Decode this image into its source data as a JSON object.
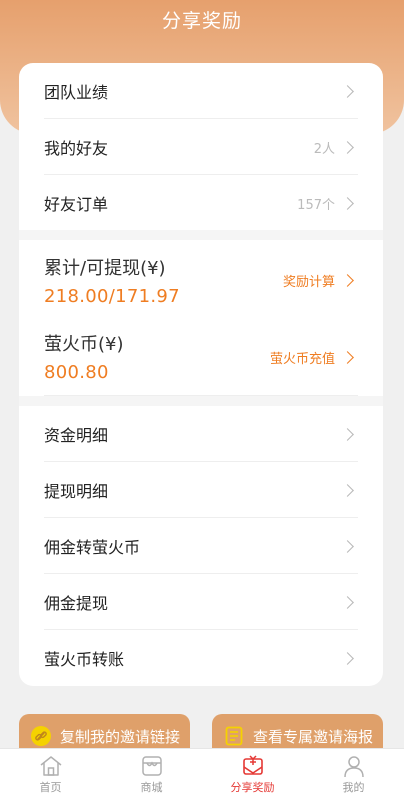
{
  "header": {
    "title": "分享奖励"
  },
  "menu_top": [
    {
      "label": "团队业绩",
      "count": ""
    },
    {
      "label": "我的好友",
      "count": "2人"
    },
    {
      "label": "好友订单",
      "count": "157个"
    }
  ],
  "stats": [
    {
      "label": "累计/可提现(¥)",
      "value": "218.00/171.97",
      "link": "奖励计算"
    },
    {
      "label": "萤火币(¥)",
      "value": "800.80",
      "link": "萤火币充值"
    }
  ],
  "menu_bottom": [
    {
      "label": "资金明细"
    },
    {
      "label": "提现明细"
    },
    {
      "label": "佣金转萤火币"
    },
    {
      "label": "佣金提现"
    },
    {
      "label": "萤火币转账"
    }
  ],
  "actions": {
    "copy_link": "复制我的邀请链接",
    "view_poster": "查看专属邀请海报"
  },
  "tabbar": {
    "items": [
      {
        "label": "首页",
        "icon": "home-icon"
      },
      {
        "label": "商城",
        "icon": "shop-icon"
      },
      {
        "label": "分享奖励",
        "icon": "share-reward-icon",
        "active": true
      },
      {
        "label": "我的",
        "icon": "user-icon"
      }
    ]
  },
  "colors": {
    "accent": "#ef7d22",
    "header": "#e6a06d",
    "active_tab": "#e53935"
  }
}
